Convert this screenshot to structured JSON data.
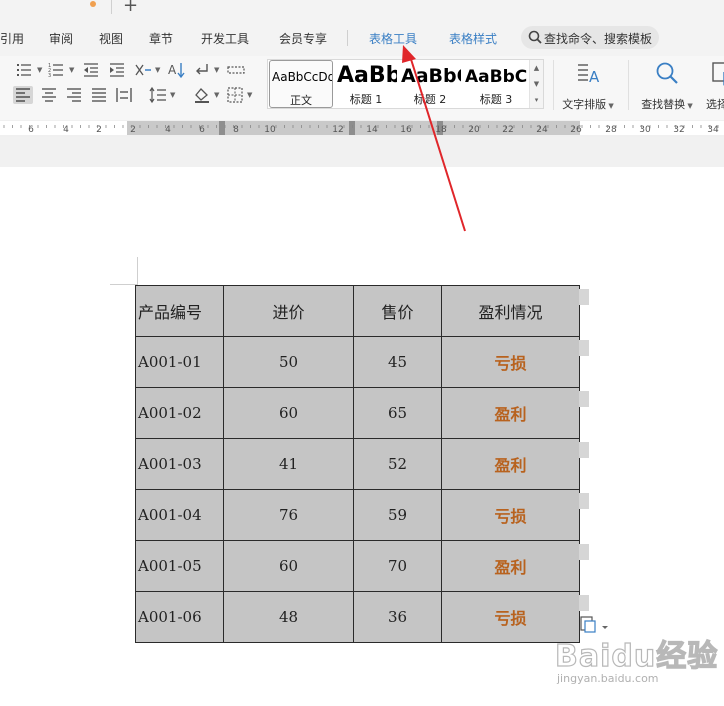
{
  "menu": {
    "items": [
      "引用",
      "审阅",
      "视图",
      "章节",
      "开发工具",
      "会员专享",
      "表格工具",
      "表格样式"
    ],
    "highlighted": [
      "表格工具",
      "表格样式"
    ],
    "search_placeholder": "查找命令、搜索模板",
    "highlight_color": "#3a7fc4"
  },
  "ribbon": {
    "styles": [
      {
        "preview": "AaBbCcDd",
        "name": "正文"
      },
      {
        "preview": "AaBb",
        "name": "标题 1"
      },
      {
        "preview": "AaBbC",
        "name": "标题 2"
      },
      {
        "preview": "AaBbC",
        "name": "标题 3"
      }
    ],
    "text_layout_label": "文字排版",
    "find_replace_label": "查找替换",
    "select_label": "选择"
  },
  "ruler": {
    "labels": [
      "6",
      "4",
      "2",
      "2",
      "4",
      "6",
      "8",
      "10",
      "12",
      "14",
      "16",
      "18",
      "20",
      "22",
      "24",
      "26",
      "28",
      "30",
      "32",
      "34"
    ]
  },
  "table": {
    "headers": [
      "产品编号",
      "进价",
      "售价",
      "盈利情况"
    ],
    "rows": [
      [
        "A001-01",
        "50",
        "45",
        "亏损"
      ],
      [
        "A001-02",
        "60",
        "65",
        "盈利"
      ],
      [
        "A001-03",
        "41",
        "52",
        "盈利"
      ],
      [
        "A001-04",
        "76",
        "59",
        "亏损"
      ],
      [
        "A001-05",
        "60",
        "70",
        "盈利"
      ],
      [
        "A001-06",
        "48",
        "36",
        "亏损"
      ]
    ],
    "cell_bg": "#c5c5c5",
    "status_color": "#b8621e"
  },
  "annotation": {
    "arrow_color": "#e0262a"
  },
  "watermark": {
    "logo": "Baidu经验",
    "url": "jingyan.baidu.com"
  }
}
